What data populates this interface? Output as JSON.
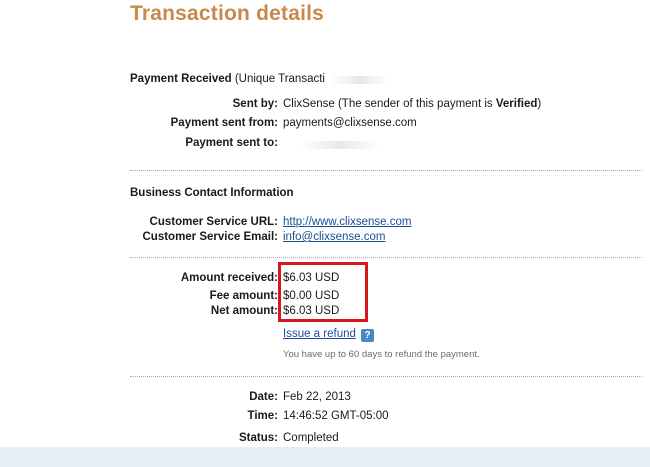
{
  "title": "Transaction details",
  "payment": {
    "heading_bold": "Payment Received",
    "heading_rest": " (Unique Transacti",
    "sent_by_label": "Sent by:",
    "sent_by_value": "ClixSense (The sender of this payment is ",
    "sent_by_verified": "Verified",
    "sent_by_close": ")",
    "sent_from_label": "Payment sent from:",
    "sent_from_value": "payments@clixsense.com",
    "sent_to_label": "Payment sent to:"
  },
  "business": {
    "heading": "Business Contact Information",
    "url_label": "Customer Service URL:",
    "url_value": "http://www.clixsense.com",
    "email_label": "Customer Service Email:",
    "email_value": "info@clixsense.com"
  },
  "amounts": {
    "received_label": "Amount received:",
    "received_value": "$6.03 USD",
    "fee_label": "Fee amount:",
    "fee_value": "$0.00 USD",
    "net_label": "Net amount:",
    "net_value": "$6.03 USD",
    "refund_link": "Issue a refund",
    "help_glyph": "?",
    "refund_note": "You have up to 60 days to refund the payment."
  },
  "details": {
    "date_label": "Date:",
    "date_value": "Feb 22, 2013",
    "time_label": "Time:",
    "time_value": "14:46:52 GMT-05:00",
    "status_label": "Status:",
    "status_value": "Completed"
  },
  "colors": {
    "title": "#c8894a",
    "link": "#1b4d99",
    "highlight_border": "#d4161f",
    "help_icon": "#4a87c9"
  }
}
